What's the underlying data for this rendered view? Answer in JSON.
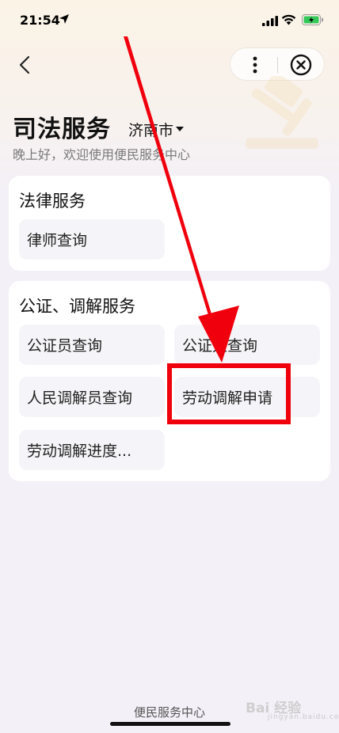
{
  "status_bar": {
    "time": "21:54",
    "icons": [
      "location-arrow-icon",
      "cellular-signal-icon",
      "wifi-icon",
      "battery-charging-icon"
    ],
    "battery_color": "#34c759"
  },
  "nav": {
    "icons": [
      "back-chevron-icon",
      "more-dots-icon",
      "close-circle-icon"
    ]
  },
  "header": {
    "title": "司法服务",
    "city": "济南市",
    "greeting": "晚上好，欢迎使用便民服务中心"
  },
  "sections": [
    {
      "title": "法律服务",
      "items": [
        {
          "label": "律师查询"
        }
      ]
    },
    {
      "title": "公证、调解服务",
      "items": [
        {
          "label": "公证员查询"
        },
        {
          "label": "公证处查询"
        },
        {
          "label": "人民调解员查询"
        },
        {
          "label": "劳动调解申请"
        },
        {
          "label": "劳动调解进度..."
        }
      ]
    }
  ],
  "annotation": {
    "color": "#f0000c",
    "highlight_target": "劳动调解申请"
  },
  "footer": {
    "label": "便民服务中心"
  },
  "watermark": {
    "text": "Bai 经验",
    "sub": "jingyan.baidu.com"
  }
}
